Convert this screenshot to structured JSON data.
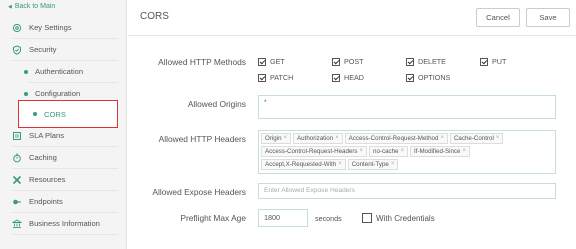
{
  "sidebar": {
    "back": "Back to Main",
    "items": [
      {
        "label": "Key Settings",
        "icon": "gear-icon"
      },
      {
        "label": "Security",
        "icon": "shield-icon"
      },
      {
        "label": "Authentication",
        "sub": true
      },
      {
        "label": "Configuration",
        "sub": true
      },
      {
        "label": "CORS",
        "sub": true,
        "active": true
      },
      {
        "label": "SLA Plans",
        "icon": "document-icon"
      },
      {
        "label": "Caching",
        "icon": "stopwatch-icon"
      },
      {
        "label": "Resources",
        "icon": "tools-icon"
      },
      {
        "label": "Endpoints",
        "icon": "endpoint-icon"
      },
      {
        "label": "Business Information",
        "icon": "bank-icon"
      }
    ]
  },
  "header": {
    "title": "CORS",
    "cancel_label": "Cancel",
    "save_label": "Save"
  },
  "form": {
    "methods_label": "Allowed HTTP Methods",
    "methods": [
      {
        "label": "GET",
        "checked": true
      },
      {
        "label": "POST",
        "checked": true
      },
      {
        "label": "DELETE",
        "checked": true
      },
      {
        "label": "PUT",
        "checked": true
      },
      {
        "label": "PATCH",
        "checked": true
      },
      {
        "label": "HEAD",
        "checked": true
      },
      {
        "label": "OPTIONS",
        "checked": true
      }
    ],
    "origins_label": "Allowed Origins",
    "origins_value": "*",
    "headers_label": "Allowed HTTP Headers",
    "headers": [
      "Origin",
      "Authorization",
      "Access-Control-Request-Method",
      "Cache-Control",
      "Access-Control-Request-Headers",
      "no-cache",
      "If-Modified-Since",
      "Accept,X-Requested-With",
      "Content-Type"
    ],
    "expose_label": "Allowed Expose Headers",
    "expose_placeholder": "Enter Allowed Expose Headers",
    "max_age_label": "Preflight Max Age",
    "max_age_value": "1800",
    "max_age_unit": "seconds",
    "credentials_label": "With Credentials",
    "credentials_checked": false
  },
  "colors": {
    "accent": "#3a9a7a",
    "highlight": "#d33333"
  }
}
